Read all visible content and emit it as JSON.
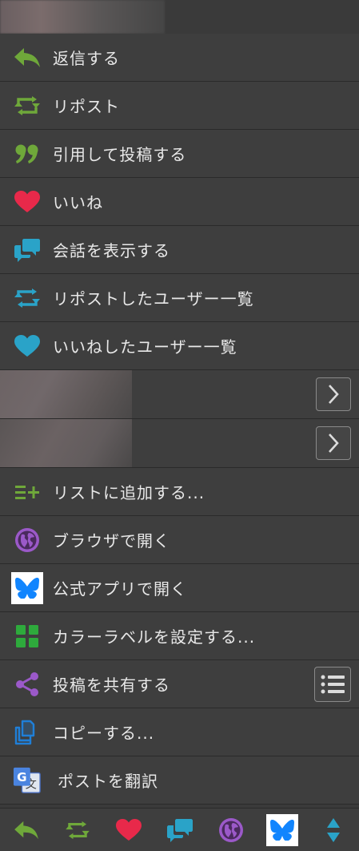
{
  "menu": {
    "items": [
      {
        "label": "返信する",
        "icon": "reply-icon"
      },
      {
        "label": "リポスト",
        "icon": "repost-icon"
      },
      {
        "label": "引用して投稿する",
        "icon": "quote-icon"
      },
      {
        "label": "いいね",
        "icon": "heart-icon"
      },
      {
        "label": "会話を表示する",
        "icon": "conversation-icon"
      },
      {
        "label": "リポストしたユーザー一覧",
        "icon": "repost-users-icon"
      },
      {
        "label": "いいねしたユーザー一覧",
        "icon": "liked-users-icon"
      },
      {
        "label": "リストに追加する...",
        "icon": "list-add-icon"
      },
      {
        "label": "ブラウザで開く",
        "icon": "globe-icon"
      },
      {
        "label": "公式アプリで開く",
        "icon": "bluesky-app-icon"
      },
      {
        "label": "カラーラベルを設定する...",
        "icon": "color-label-icon"
      },
      {
        "label": "投稿を共有する",
        "icon": "share-icon"
      },
      {
        "label": "コピーする...",
        "icon": "copy-icon"
      },
      {
        "label": "ポストを翻訳",
        "icon": "translate-icon"
      }
    ]
  },
  "colors": {
    "green": "#6fa83a",
    "red": "#e8294a",
    "blue": "#2aa3c8",
    "purple": "#9b59c9",
    "bluesky": "#1185fe",
    "background": "#3a3a3a"
  }
}
